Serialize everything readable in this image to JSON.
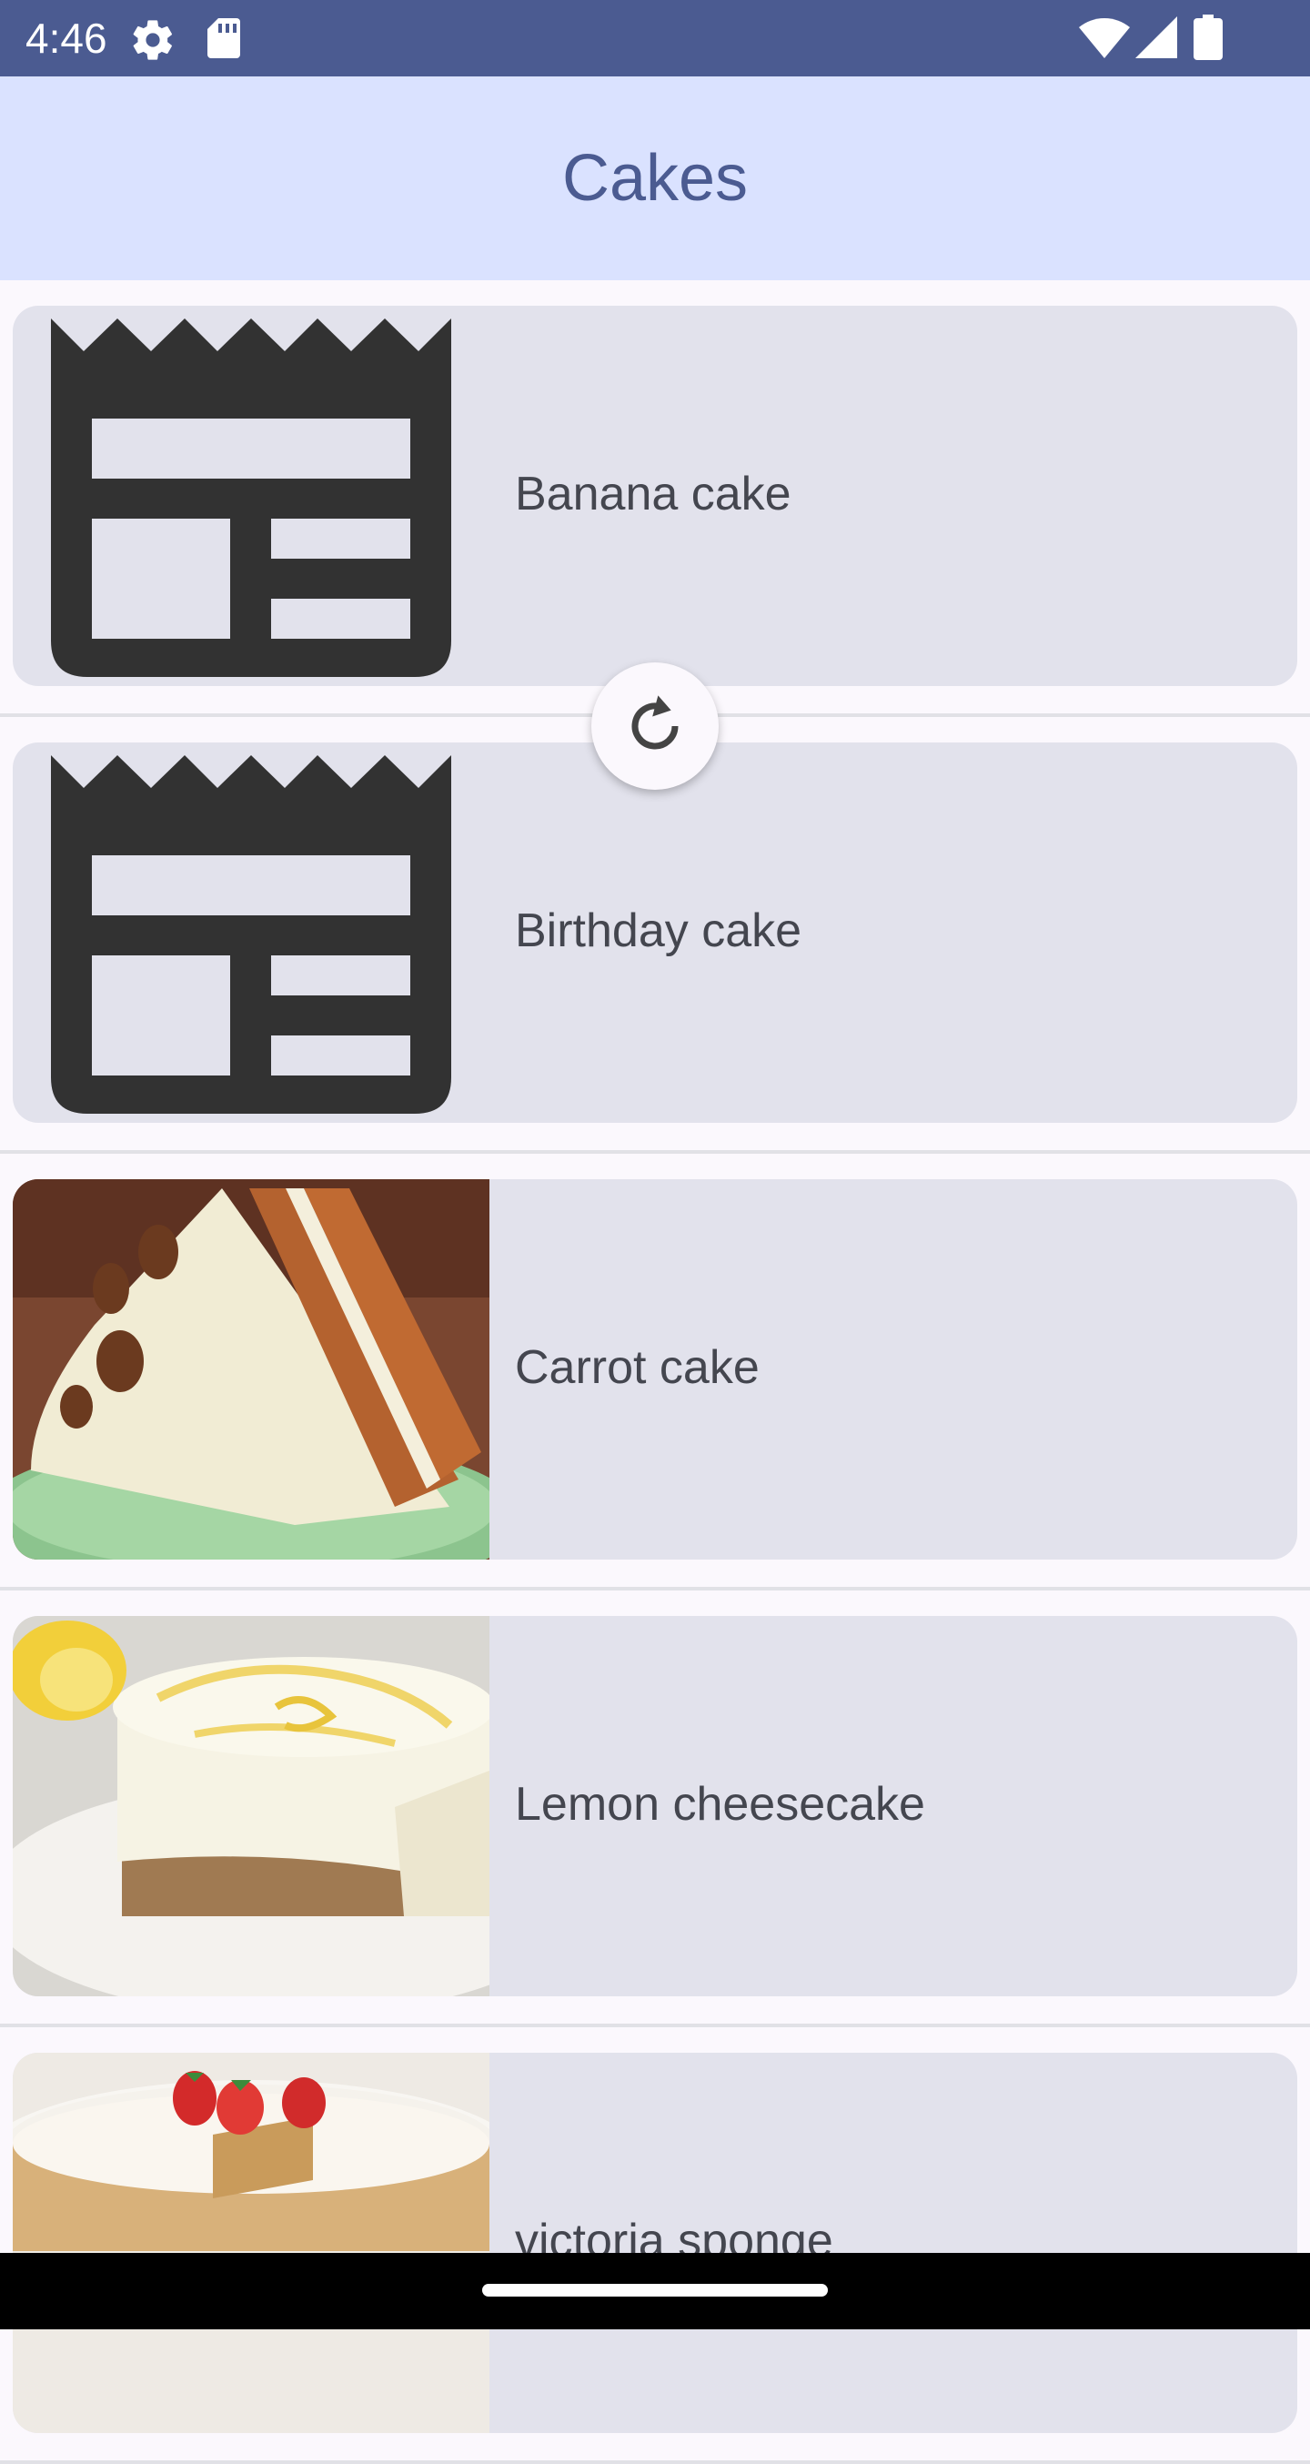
{
  "status_bar": {
    "time": "4:46",
    "icons": [
      "settings-gear-icon",
      "sd-card-icon",
      "wifi-icon",
      "cellular-signal-icon",
      "battery-icon"
    ]
  },
  "app_bar": {
    "title": "Cakes"
  },
  "cakes": [
    {
      "name": "Banana cake",
      "image": "placeholder-image-icon"
    },
    {
      "name": "Birthday cake",
      "image": "placeholder-image-icon"
    },
    {
      "name": "Carrot cake",
      "image": "carrot-cake-photo"
    },
    {
      "name": "Lemon cheesecake",
      "image": "lemon-cheesecake-photo"
    },
    {
      "name": "victoria sponge",
      "image": "victoria-sponge-photo"
    }
  ],
  "refresh_indicator": {
    "icon": "refresh-icon"
  },
  "colors": {
    "status_bar": "#4b5b91",
    "app_bar": "#dae2ff",
    "title": "#4b5b91",
    "card": "#e2e2ec",
    "label": "#44464f",
    "background": "#fbf8fd"
  }
}
